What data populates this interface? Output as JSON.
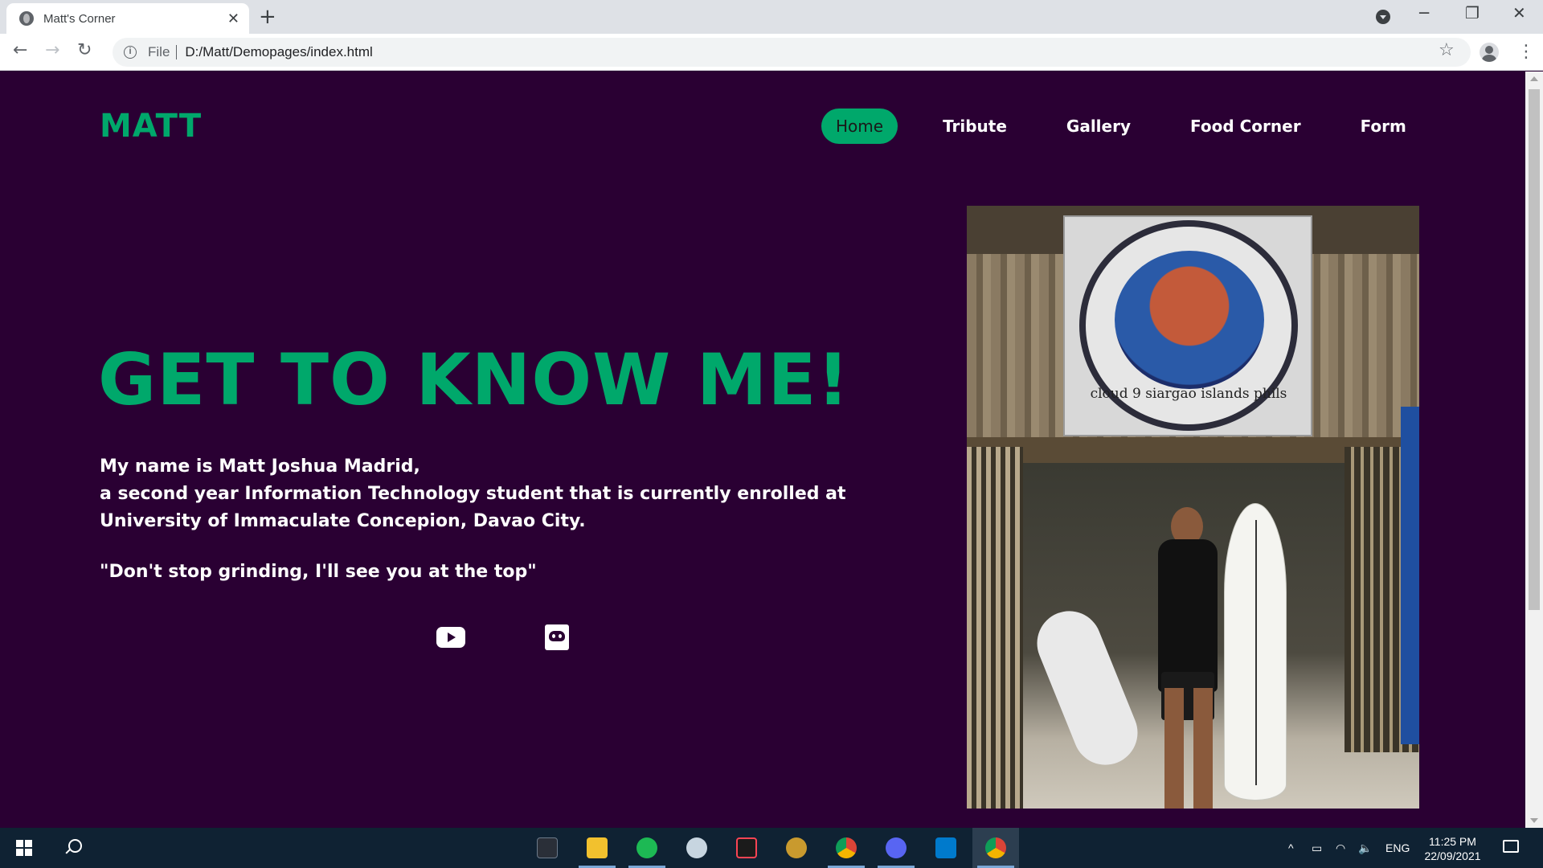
{
  "browser": {
    "tab_title": "Matt's Corner",
    "tab_close": "✕",
    "new_tab": "+",
    "window_controls": {
      "minimize": "─",
      "restore": "❐",
      "close": "✕"
    },
    "nav": {
      "back": "←",
      "forward": "→",
      "reload": "↻"
    },
    "address": {
      "info": "i",
      "scheme": "File",
      "url": "D:/Matt/Demopages/index.html"
    },
    "bookmark": "☆",
    "menu": "⋮"
  },
  "site": {
    "logo": "MATT",
    "nav": [
      "Home",
      "Tribute",
      "Gallery",
      "Food Corner",
      "Form"
    ],
    "active_nav": "Home",
    "hero_title": "GET TO KNOW ME!",
    "bio_line1": "My name is Matt Joshua Madrid,",
    "bio_line2": "a second year Information Technology student that is currently enrolled at University of Immaculate Concepion, Davao City.",
    "quote": "\"Don't stop grinding, I'll see you at the top\"",
    "social": [
      "youtube-icon",
      "discord-icon"
    ],
    "photo_banner_text": "cloud 9 siargao islands phils",
    "colors": {
      "accent": "#00a86b",
      "background": "#2a0033",
      "text": "#ffffff"
    }
  },
  "taskbar": {
    "apps": [
      "predator-sense",
      "file-explorer",
      "spotify",
      "steam",
      "valorant",
      "world-of-warcraft",
      "chrome-profile",
      "discord",
      "visual-studio-code",
      "chrome"
    ],
    "language": "ENG",
    "time": "11:25 PM",
    "date": "22/09/2021",
    "tray_chevron": "^"
  }
}
